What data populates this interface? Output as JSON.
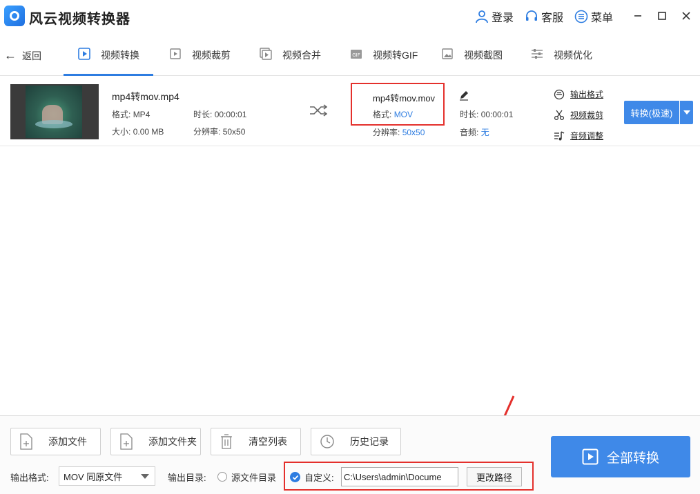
{
  "app": {
    "title": "风云视频转换器"
  },
  "titlebar": {
    "login": "登录",
    "service": "客服",
    "menu": "菜单"
  },
  "nav": {
    "back": "返回",
    "tabs": [
      {
        "label": "视频转换",
        "icon": "video-convert-icon"
      },
      {
        "label": "视频裁剪",
        "icon": "video-crop-icon"
      },
      {
        "label": "视频合并",
        "icon": "video-merge-icon"
      },
      {
        "label": "视频转GIF",
        "icon": "gif-icon"
      },
      {
        "label": "视频截图",
        "icon": "screenshot-icon"
      },
      {
        "label": "视频优化",
        "icon": "optimize-icon"
      }
    ]
  },
  "file": {
    "name": "mp4转mov.mp4",
    "format_label": "格式:",
    "format": "MP4",
    "duration_label": "时长:",
    "duration": "00:00:01",
    "size_label": "大小:",
    "size": "0.00 MB",
    "resolution_label": "分辨率:",
    "resolution": "50x50",
    "output": {
      "name": "mp4转mov.mov",
      "format_label": "格式:",
      "format": "MOV",
      "duration_label": "时长:",
      "duration": "00:00:01",
      "resolution_label": "分辨率:",
      "resolution": "50x50",
      "audio_label": "音频:",
      "audio": "无"
    },
    "links": {
      "output_format": "输出格式",
      "video_crop": "视频裁剪",
      "audio_adjust": "音频调整"
    },
    "convert_button": "转换(极速)"
  },
  "bottom": {
    "add_file": "添加文件",
    "add_folder": "添加文件夹",
    "clear_list": "清空列表",
    "history": "历史记录",
    "output_format_label": "输出格式:",
    "output_format_value": "MOV 同原文件",
    "output_dir_label": "输出目录:",
    "source_dir": "源文件目录",
    "custom_label": "自定义:",
    "custom_path": "C:\\Users\\admin\\Docume",
    "change_path": "更改路径",
    "convert_all": "全部转换"
  },
  "colors": {
    "accent": "#3f89e8",
    "highlight": "#e4302c"
  }
}
